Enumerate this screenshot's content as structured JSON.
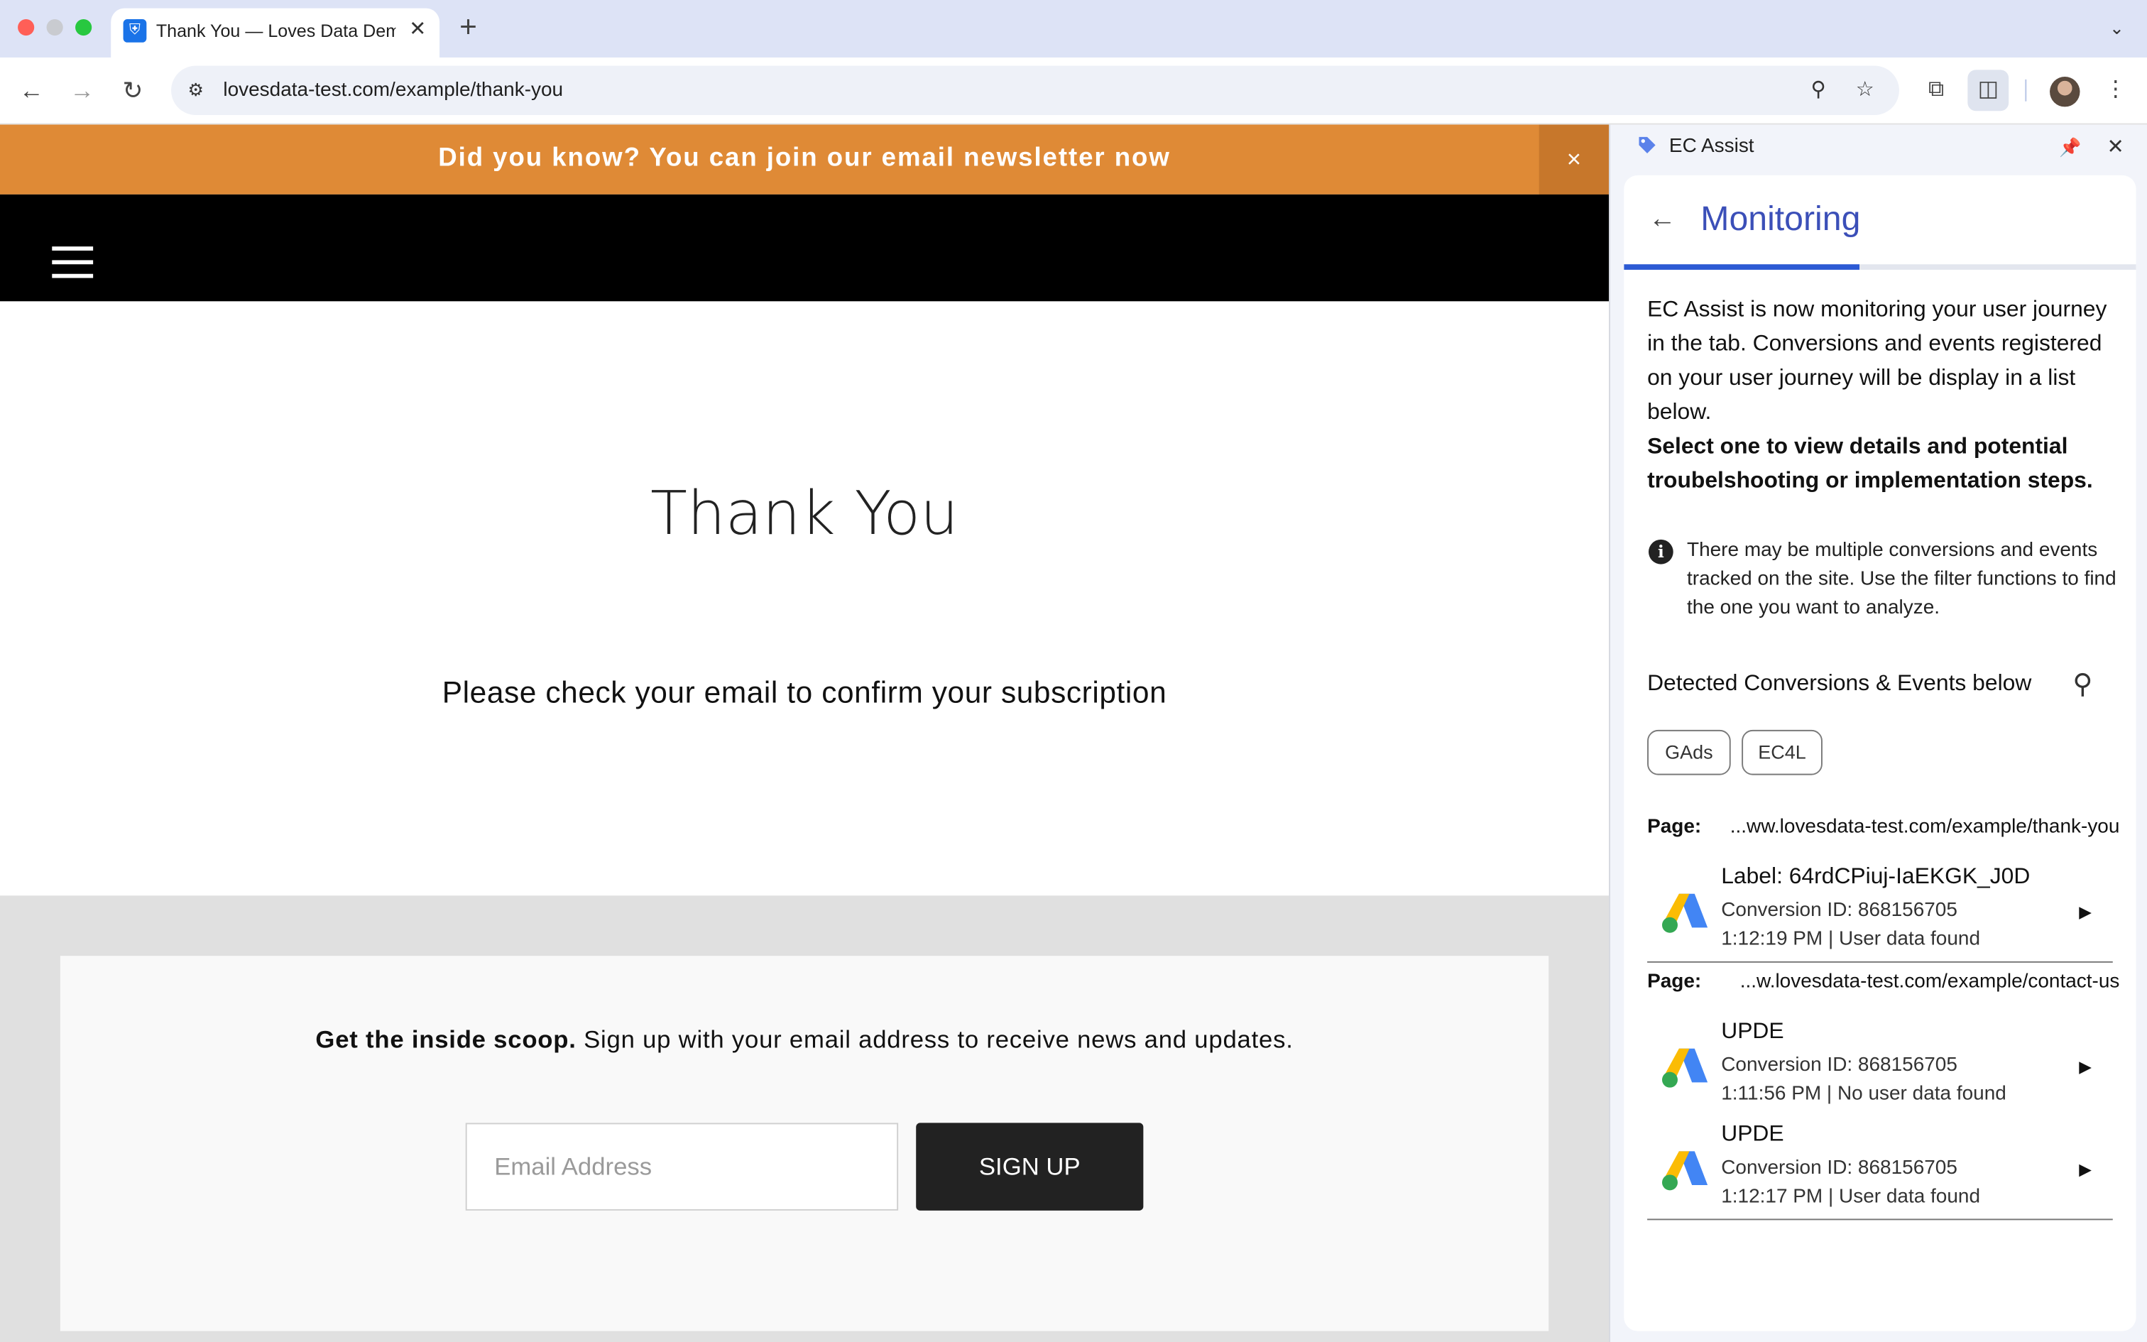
{
  "browser": {
    "tab_title": "Thank You — Loves Data Demo",
    "tab_favicon": "shield-icon",
    "new_tab_glyph": "+",
    "url": "lovesdata-test.com/example/thank-you"
  },
  "page": {
    "banner_text": "Did you know? You can join our email newsletter now",
    "banner_close": "×",
    "heading": "Thank You",
    "subheading": "Please check your email to confirm your subscription",
    "newsletter_bold": "Get the inside scoop.",
    "newsletter_text": " Sign up with your email address to receive news and updates.",
    "email_placeholder": "Email Address",
    "signup_label": "SIGN UP"
  },
  "side_panel": {
    "title": "EC Assist",
    "view_title": "Monitoring",
    "progress_fraction": 0.46,
    "description": "EC Assist is now monitoring your user journey in the tab. Conversions and events registered on your user journey will be display in a list below.",
    "description_bold": "Select one to view details and potential troubelshooting or implementation steps.",
    "info_text": "There may be multiple conversions and events tracked on the site. Use the filter functions to find the one you want to analyze.",
    "detected_heading": "Detected Conversions & Events below",
    "filters": [
      "GAds",
      "EC4L"
    ],
    "page_label": "Page:",
    "groups": [
      {
        "page_url": "...ww.lovesdata-test.com/example/thank-you",
        "items": [
          {
            "name": "Label: 64rdCPiuj-IaEKGK_J0D",
            "conversion_id": "Conversion ID: 868156705",
            "time_status": "1:12:19 PM | User data found"
          }
        ]
      },
      {
        "page_url": "...w.lovesdata-test.com/example/contact-us",
        "items": [
          {
            "name": "UPDE",
            "conversion_id": "Conversion ID: 868156705",
            "time_status": "1:11:56 PM | No user data found"
          },
          {
            "name": "UPDE",
            "conversion_id": "Conversion ID: 868156705",
            "time_status": "1:12:17 PM | User data found"
          }
        ]
      }
    ]
  },
  "colors": {
    "banner": "#df8a36",
    "accent": "#3b4fb8",
    "progress": "#2c5ad4"
  }
}
